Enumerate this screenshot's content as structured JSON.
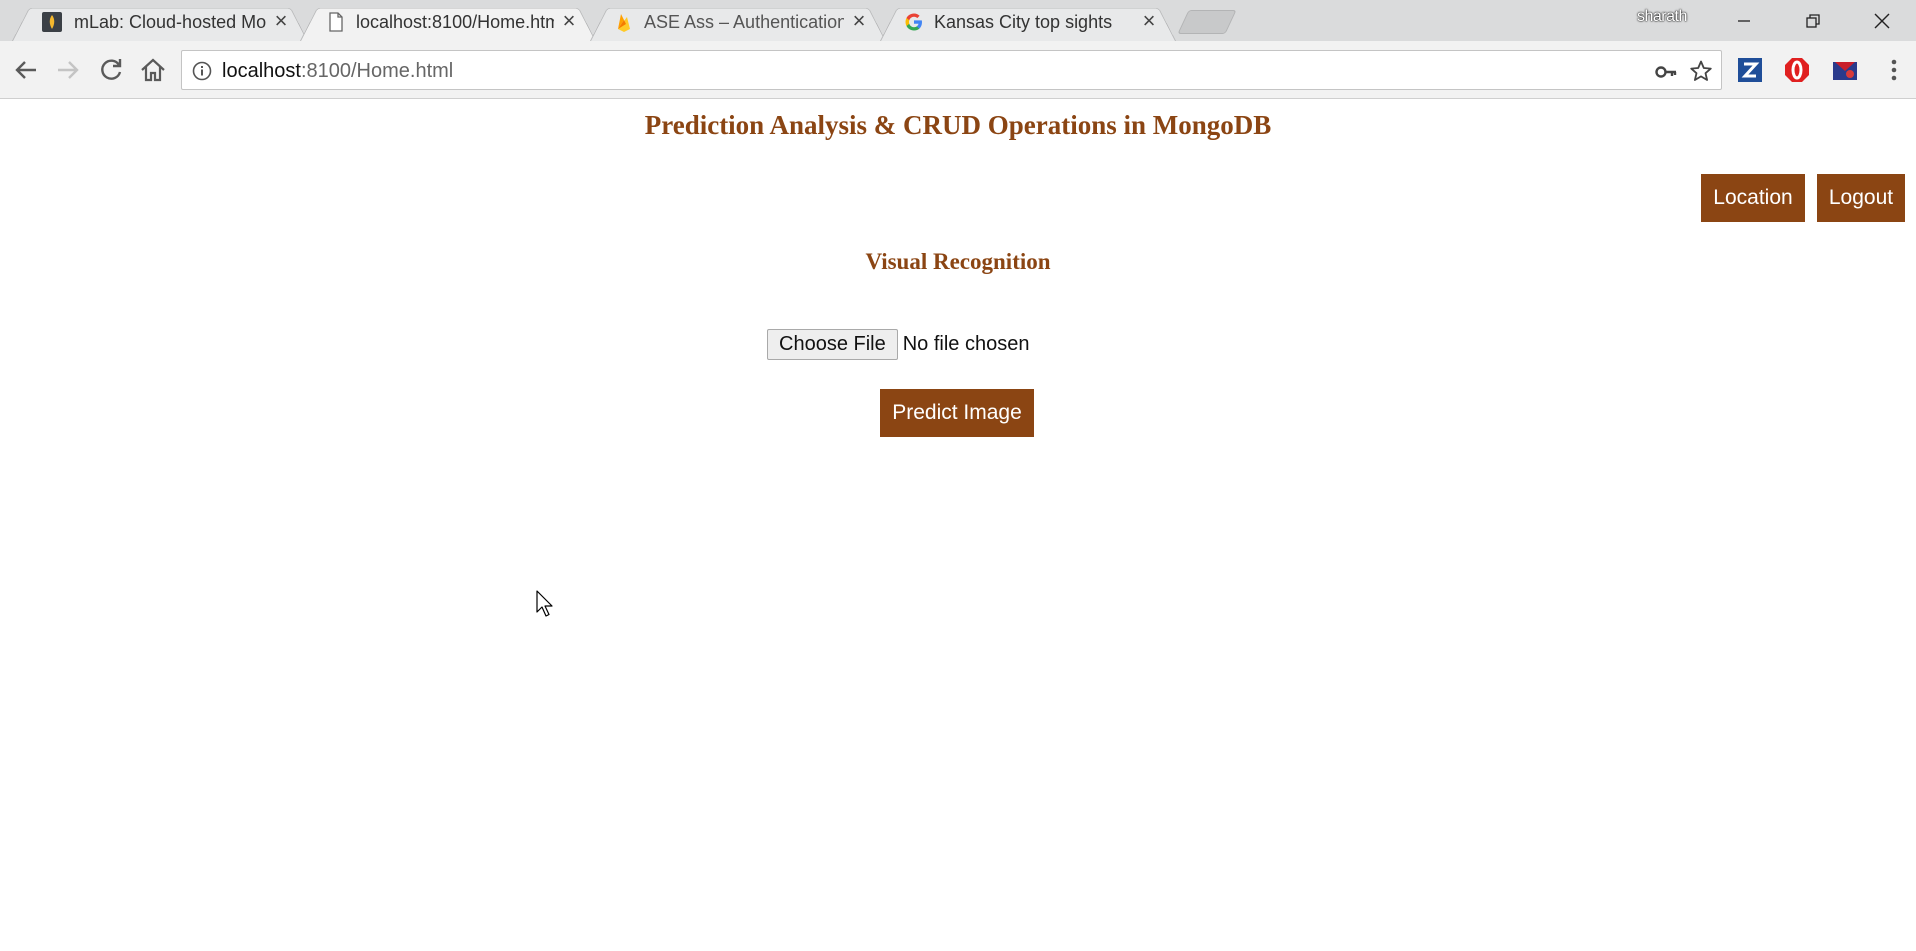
{
  "browser": {
    "tabs": [
      {
        "title": "mLab: Cloud-hosted Mo",
        "favicon": "mlab-icon"
      },
      {
        "title": "localhost:8100/Home.htm",
        "favicon": "page-icon"
      },
      {
        "title": "ASE Ass – Authentication",
        "favicon": "firebase-icon"
      },
      {
        "title": "Kansas City top sights",
        "favicon": "google-icon"
      }
    ],
    "profile_name": "sharath",
    "url_host": "localhost",
    "url_path": ":8100/Home.html"
  },
  "page": {
    "title": "Prediction Analysis & CRUD Operations in MongoDB",
    "nav_buttons": {
      "location": "Location",
      "logout": "Logout"
    },
    "section_title": "Visual Recognition",
    "file_input": {
      "button_label": "Choose File",
      "status": "No file chosen"
    },
    "predict_button": "Predict Image"
  },
  "colors": {
    "accent": "#8b4513",
    "button_text": "#ffffff"
  }
}
